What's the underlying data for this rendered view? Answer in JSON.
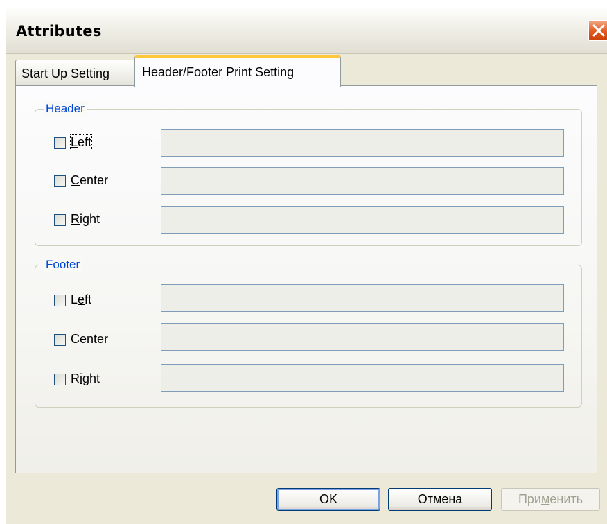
{
  "window": {
    "title": "Attributes"
  },
  "tabs": [
    {
      "label": "Start Up Setting",
      "active": false
    },
    {
      "label": "Header/Footer Print Setting",
      "active": true
    }
  ],
  "header_group": {
    "legend": "Header",
    "rows": [
      {
        "mnemonic": "L",
        "rest": "eft",
        "checked": false,
        "value": ""
      },
      {
        "mnemonic": "C",
        "rest": "enter",
        "checked": false,
        "value": ""
      },
      {
        "mnemonic": "R",
        "rest": "ight",
        "checked": false,
        "value": ""
      }
    ]
  },
  "footer_group": {
    "legend": "Footer",
    "rows": [
      {
        "pre": "L",
        "mnemonic": "e",
        "rest": "ft",
        "checked": false,
        "value": ""
      },
      {
        "pre": "Ce",
        "mnemonic": "n",
        "rest": "ter",
        "checked": false,
        "value": ""
      },
      {
        "pre": "R",
        "mnemonic": "i",
        "rest": "ght",
        "checked": false,
        "value": ""
      }
    ]
  },
  "buttons": {
    "ok": "OK",
    "cancel": "Отмена",
    "apply_pre": "При",
    "apply_mnemonic": "м",
    "apply_rest": "енить"
  },
  "colors": {
    "group_legend": "#0046d5",
    "active_tab_highlight": "#ffc83c",
    "close_button": "#e35b20"
  }
}
